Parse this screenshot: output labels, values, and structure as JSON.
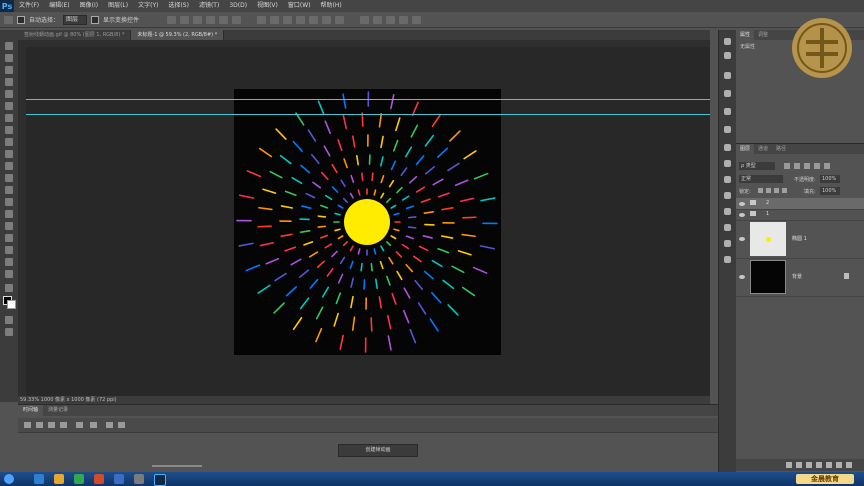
{
  "app": {
    "logo": "Ps"
  },
  "menubar": [
    "文件(F)",
    "编辑(E)",
    "图像(I)",
    "图层(L)",
    "文字(Y)",
    "选择(S)",
    "滤镜(T)",
    "3D(D)",
    "视图(V)",
    "窗口(W)",
    "帮助(H)"
  ],
  "options": {
    "auto_select_label": "自动选择：",
    "auto_select_value": "图层",
    "show_transform_label": "显示变换控件"
  },
  "tabs": [
    "签射线蜻动画.gif @ 80% (图层 1, RGB/8) *",
    "未标题-1 @ 59.3% (2, RGB/8#) *"
  ],
  "status": {
    "text": "59.33%   1000 像素 x 1000 像素 (72 ppi)"
  },
  "timeline": {
    "tabs": [
      "时间轴",
      "测量记录"
    ],
    "create_button": "创建帧动画"
  },
  "properties": {
    "tabs": [
      "属性",
      "调整"
    ],
    "empty_text": "无属性"
  },
  "layers": {
    "tabs": [
      "图层",
      "通道",
      "路径"
    ],
    "kind_filter": "ρ 类型",
    "blend_mode": "正常",
    "opacity_label": "不透明度:",
    "opacity_value": "100%",
    "lock_label": "锁定:",
    "fill_label": "填充:",
    "fill_value": "100%",
    "items": [
      {
        "name": "2",
        "type": "group"
      },
      {
        "name": "1",
        "type": "group"
      },
      {
        "name": "椭圆 1",
        "type": "shape"
      },
      {
        "name": "背景",
        "type": "background"
      }
    ]
  },
  "brand": {
    "name": "金晨教育"
  },
  "colors": {
    "canvas_bg": "#050505",
    "sun": "#ffec00",
    "guide": "#49c5d6"
  }
}
